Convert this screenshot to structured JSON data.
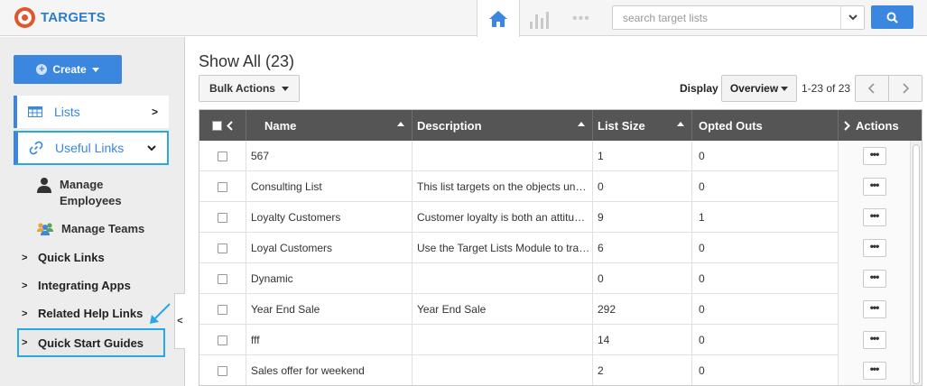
{
  "app": {
    "title": "TARGETS"
  },
  "header": {
    "search_placeholder": "search target lists",
    "more_label": "•••"
  },
  "sidebar": {
    "create_label": "Create",
    "lists_label": "Lists",
    "useful_links_label": "Useful Links",
    "sub_links": [
      {
        "label": "Manage Employees"
      },
      {
        "label": "Manage Teams"
      }
    ],
    "groups": [
      {
        "label": "Quick Links"
      },
      {
        "label": "Integrating Apps"
      },
      {
        "label": "Related Help Links"
      },
      {
        "label": "Quick Start Guides"
      }
    ]
  },
  "main": {
    "title": "Show All (23)",
    "bulk_actions_label": "Bulk Actions",
    "display_label": "Display",
    "display_value": "Overview",
    "pager_text": "1-23 of 23",
    "columns": {
      "name": "Name",
      "description": "Description",
      "list_size": "List Size",
      "opted_outs": "Opted Outs",
      "actions": "Actions"
    },
    "actions_button_label": "•••",
    "rows": [
      {
        "name": "567",
        "description": "",
        "list_size": "1",
        "opted_outs": "0"
      },
      {
        "name": "Consulting List",
        "description": "This list targets on the objects under consultation",
        "list_size": "0",
        "opted_outs": "0"
      },
      {
        "name": "Loyalty Customers",
        "description": "Customer loyalty is both an attitudinal and behavioral tendency",
        "list_size": "9",
        "opted_outs": "1"
      },
      {
        "name": "Loyal Customers",
        "description": "Use the Target Lists Module to track loyal customers",
        "list_size": "6",
        "opted_outs": "0"
      },
      {
        "name": "Dynamic",
        "description": "",
        "list_size": "0",
        "opted_outs": "0"
      },
      {
        "name": "Year End Sale",
        "description": "Year End Sale",
        "list_size": "292",
        "opted_outs": "0"
      },
      {
        "name": "fff",
        "description": "",
        "list_size": "14",
        "opted_outs": "0"
      },
      {
        "name": "Sales offer for weekend",
        "description": "",
        "list_size": "2",
        "opted_outs": "0"
      }
    ]
  },
  "colors": {
    "accent": "#3b87e0",
    "highlight": "#29a8e8",
    "header_bg": "#555555",
    "logo": "#e2562b"
  }
}
